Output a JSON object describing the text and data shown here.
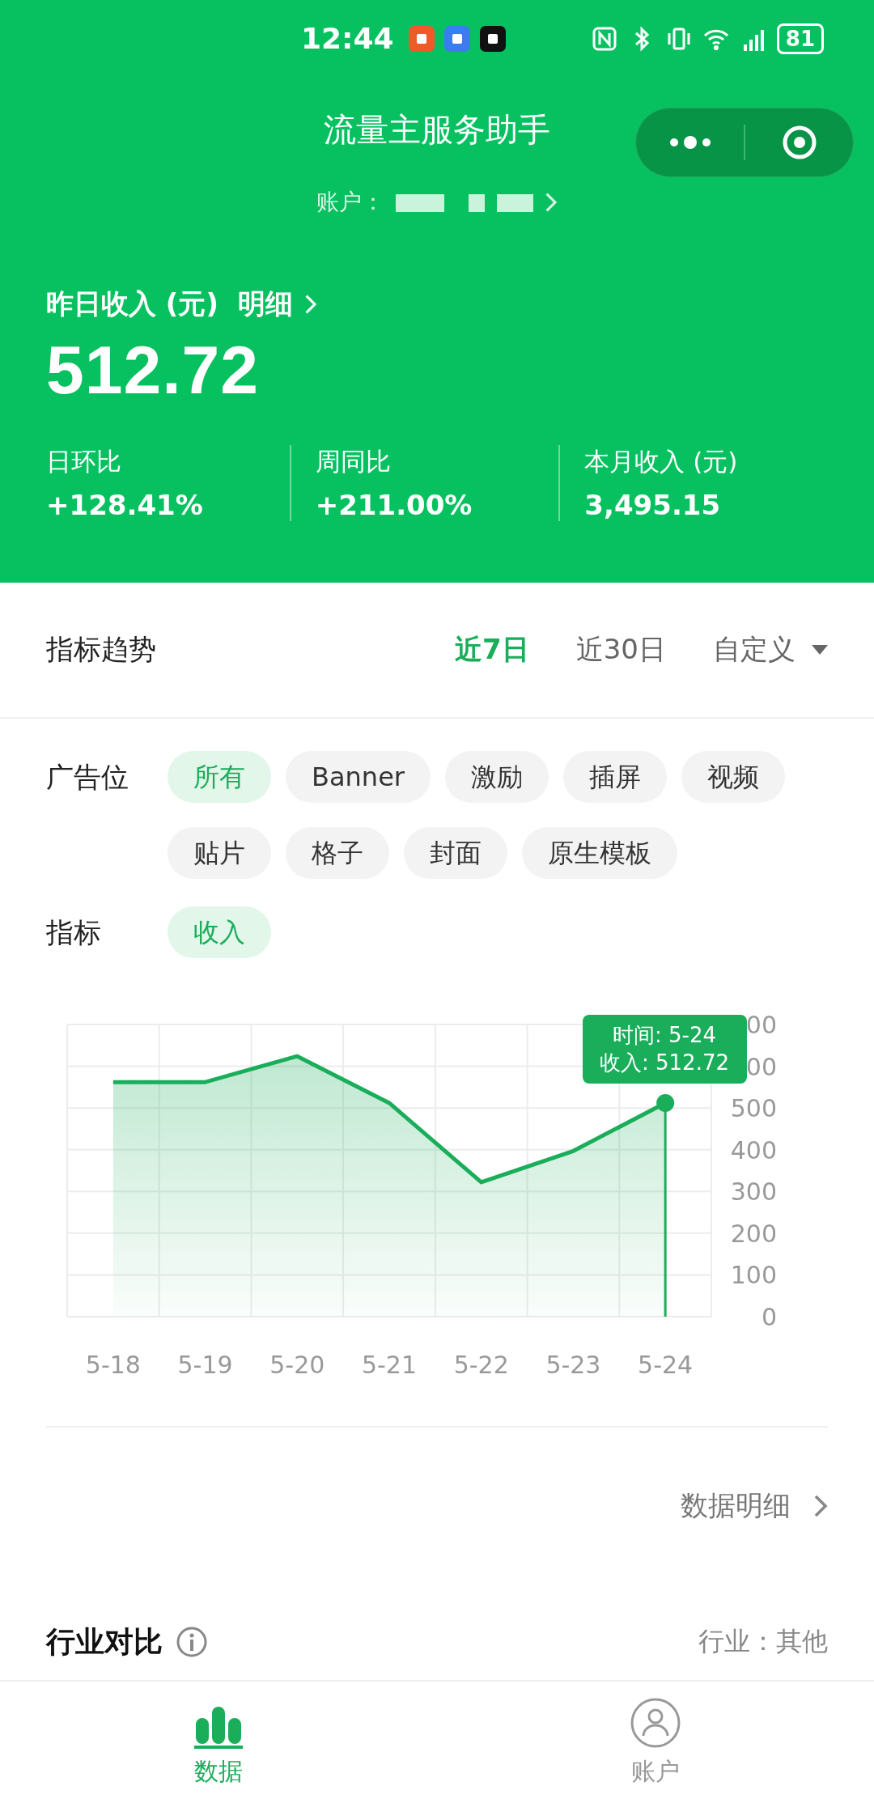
{
  "status_bar": {
    "time": "12:44",
    "battery": "81"
  },
  "title": "流量主服务助手",
  "account": {
    "label": "账户："
  },
  "summary": {
    "title": "昨日收入 (元)",
    "detail_link": "明细",
    "value": "512.72",
    "stats": [
      {
        "label": "日环比",
        "value": "+128.41%"
      },
      {
        "label": "周同比",
        "value": "+211.00%"
      },
      {
        "label": "本月收入 (元)",
        "value": "3,495.15"
      }
    ]
  },
  "trend": {
    "title": "指标趋势",
    "ranges": [
      {
        "label": "近7日",
        "selected": true,
        "kind": "option"
      },
      {
        "label": "近30日",
        "selected": false,
        "kind": "option"
      },
      {
        "label": "自定义",
        "selected": false,
        "kind": "dropdown"
      }
    ]
  },
  "filters": [
    {
      "label": "广告位",
      "options": [
        {
          "label": "所有",
          "selected": true
        },
        {
          "label": "Banner",
          "selected": false
        },
        {
          "label": "激励",
          "selected": false
        },
        {
          "label": "插屏",
          "selected": false
        },
        {
          "label": "视频",
          "selected": false
        },
        {
          "label": "贴片",
          "selected": false
        },
        {
          "label": "格子",
          "selected": false
        },
        {
          "label": "封面",
          "selected": false
        },
        {
          "label": "原生模板",
          "selected": false
        }
      ]
    },
    {
      "label": "指标",
      "options": [
        {
          "label": "收入",
          "selected": true
        }
      ]
    }
  ],
  "chart": {
    "chart_data": {
      "type": "area",
      "categories": [
        "5-18",
        "5-19",
        "5-20",
        "5-21",
        "5-22",
        "5-23",
        "5-24"
      ],
      "series": [
        {
          "color": "#1aad5a",
          "values": [
            562,
            562,
            624,
            512,
            322,
            397,
            512
          ]
        }
      ],
      "ylim": [
        0,
        700
      ],
      "yticks": [
        0,
        100,
        200,
        300,
        400,
        500
      ],
      "grid": true,
      "ref_lines": [
        {
          "axis": "x",
          "value": "5-24"
        }
      ]
    },
    "cut_tick_labels": [
      "00",
      "00"
    ],
    "tooltip": [
      "时间: 5-24",
      "收入: 512.72"
    ]
  },
  "detail_link": "数据明细",
  "industry": {
    "title": "行业对比",
    "value": "行业：其他"
  },
  "tabs": [
    {
      "label": "数据",
      "selected": true,
      "kind": "chart"
    },
    {
      "label": "账户",
      "selected": false,
      "kind": "person"
    }
  ]
}
